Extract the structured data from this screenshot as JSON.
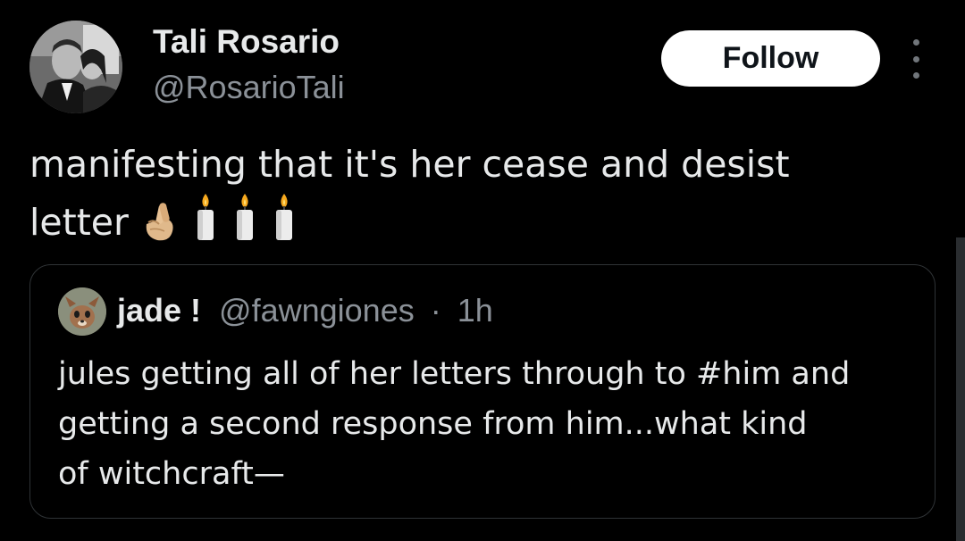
{
  "tweet": {
    "author": {
      "name": "Tali Rosario",
      "handle": "@RosarioTali"
    },
    "follow_label": "Follow",
    "text_lines": [
      "manifesting that it's her cease and desist",
      "letter"
    ],
    "emojis": [
      "crossed-fingers",
      "candle",
      "candle",
      "candle"
    ]
  },
  "quote": {
    "name": "jade !",
    "handle": "@fawngiones",
    "separator": "·",
    "time": "1h",
    "text_lines": [
      "jules getting all of her letters through to #him and",
      "getting a second response from him...what kind",
      "of witchcraft—"
    ]
  },
  "colors": {
    "background": "#000000",
    "text": "#e7e9ea",
    "secondary_text": "#8b9198",
    "border": "#2f3336",
    "follow_bg": "#ffffff",
    "follow_text": "#0f1419"
  }
}
